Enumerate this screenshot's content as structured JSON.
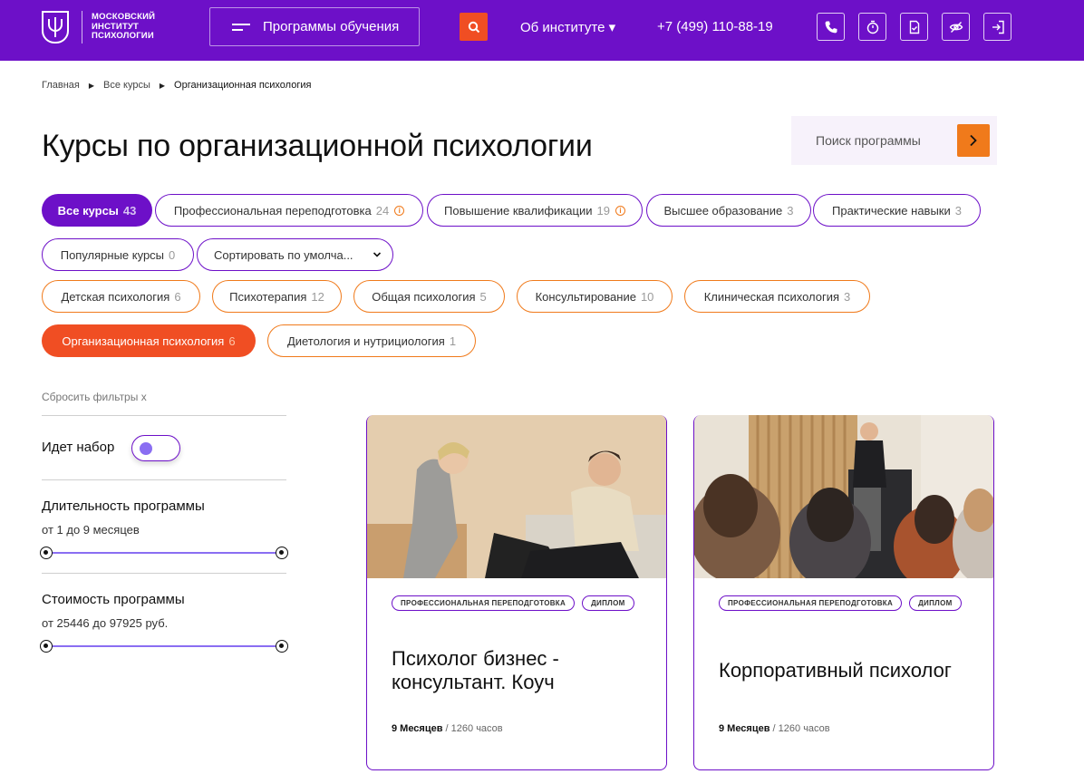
{
  "header": {
    "logo_lines": [
      "МОСКОВСКИЙ",
      "ИНСТИТУТ",
      "ПСИХОЛОГИИ"
    ],
    "programs_label": "Программы обучения",
    "about_label": "Об институте ▾",
    "phone": "+7 (499) 110-88-19",
    "icons": [
      "phone-icon",
      "timer-icon",
      "document-check-icon",
      "eye-off-icon",
      "login-icon"
    ],
    "accent": "#6d10c8"
  },
  "breadcrumb": {
    "items": [
      "Главная",
      "Все курсы",
      "Организационная психология"
    ]
  },
  "page": {
    "title": "Курсы по организационной психологии"
  },
  "search": {
    "placeholder": "Поиск программы"
  },
  "filters": {
    "row1": [
      {
        "label": "Все курсы",
        "count": "43"
      },
      {
        "label": "Профессиональная переподготовка",
        "count": "24"
      },
      {
        "label": "Повышение квалификации",
        "count": "19"
      },
      {
        "label": "Высшее образование",
        "count": "3"
      },
      {
        "label": "Практические навыки",
        "count": "3"
      }
    ],
    "row2": [
      {
        "label": "Популярные курсы",
        "count": "0"
      }
    ],
    "sort_label": "Сортировать по умолча...",
    "topics": [
      {
        "label": "Детская психология",
        "count": "6"
      },
      {
        "label": "Психотерапия",
        "count": "12"
      },
      {
        "label": "Общая психология",
        "count": "5"
      },
      {
        "label": "Консультирование",
        "count": "10"
      },
      {
        "label": "Клиническая психология",
        "count": "3"
      },
      {
        "label": "Организационная психология",
        "count": "6"
      },
      {
        "label": "Диетология и нутрициология",
        "count": "1"
      }
    ]
  },
  "sidebar": {
    "reset_label": "Сбросить фильтры x",
    "recruit_label": "Идет набор",
    "duration_title": "Длительность программы",
    "duration_range": "от 1 до 9 месяцев",
    "price_title": "Стоимость программы",
    "price_range": "от 25446 до 97925 руб."
  },
  "cards": [
    {
      "tags": [
        "Профессиональная переподготовка",
        "Диплом"
      ],
      "title": "Психолог бизнес - консультант. Коуч",
      "duration": "9 Месяцев",
      "hours": " / 1260 часов"
    },
    {
      "tags": [
        "Профессиональная переподготовка",
        "Диплом"
      ],
      "title": "Корпоративный психолог",
      "duration": "9 Месяцев",
      "hours": " / 1260 часов"
    }
  ],
  "colors": {
    "purple": "#6d10c8",
    "orange": "#f07a1b",
    "orange_active": "#f04e23"
  }
}
